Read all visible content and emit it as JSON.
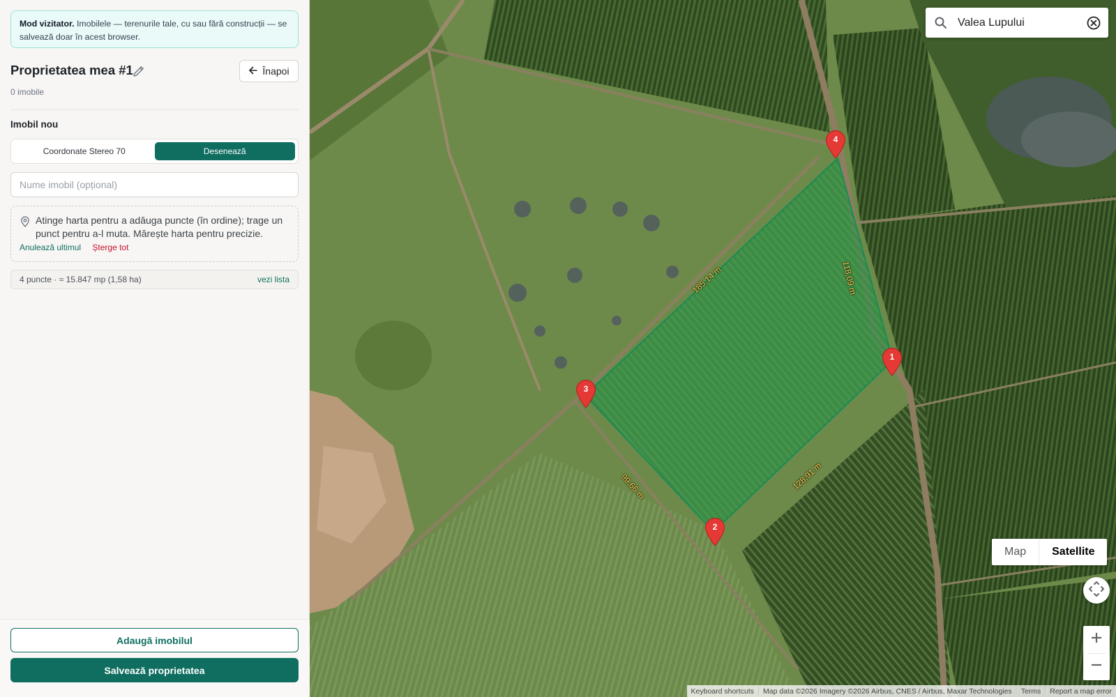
{
  "notice": {
    "bold": "Mod vizitator.",
    "text": " Imobilele — terenurile tale, cu sau fără construcții — se salvează doar în acest browser."
  },
  "property": {
    "title": "Proprietatea mea #1",
    "count": "0 imobile",
    "back_label": "Înapoi"
  },
  "new_property": {
    "section_title": "Imobil nou",
    "mode_tabs": [
      "Coordonate Stereo 70",
      "Desenează"
    ],
    "active_tab": "Desenează",
    "name_placeholder": "Nume imobil (opțional)",
    "hint": "Atinge harta pentru a adăuga puncte (în ordine); trage un punct pentru a-l muta. Mărește harta pentru precizie.",
    "undo_label": "Anulează ultimul",
    "clear_label": "Șterge tot",
    "stats": "4 puncte · ≈ 15.847 mp (1,58 ha)",
    "list_link": "vezi lista"
  },
  "actions": {
    "add_label": "Adaugă imobilul",
    "save_label": "Salvează proprietatea"
  },
  "map": {
    "search_value": "Valea Lupului",
    "map_type_options": [
      "Map",
      "Satellite"
    ],
    "map_type_selected": "Satellite",
    "markers": [
      "1",
      "2",
      "3",
      "4"
    ],
    "edge_labels": [
      "118,09 m",
      "128,91 m",
      "99,66 m",
      "185,14 m"
    ],
    "attribution": [
      "Keyboard shortcuts",
      "Map data ©2026 Imagery ©2026 Airbus, CNES / Airbus, Maxar Technologies",
      "Terms",
      "Report a map error"
    ]
  },
  "colors": {
    "accent": "#0f6e60",
    "danger": "#c8102e",
    "marker": "#e53935",
    "polygon_fill": "#1db35a",
    "edge_label": "#ffd54f"
  }
}
